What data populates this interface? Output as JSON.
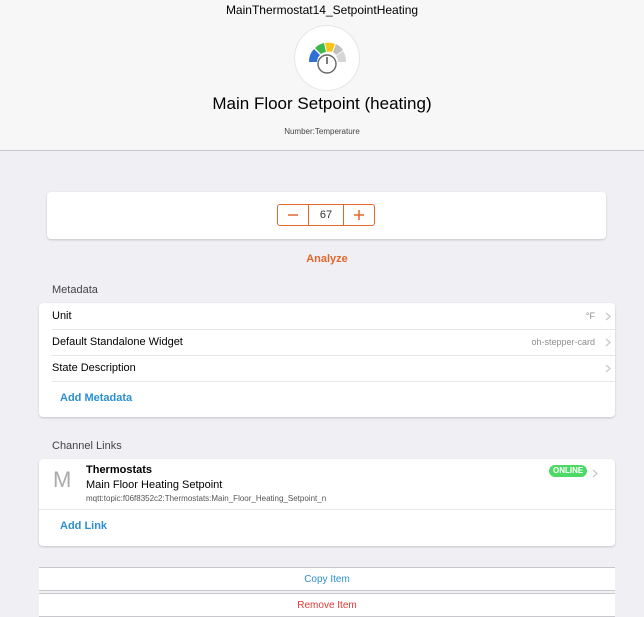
{
  "header": {
    "item_name": "MainThermostat14_SetpointHeating",
    "label": "Main Floor Setpoint (heating)",
    "type": "Number:Temperature",
    "icon": "thermostat-gauge-icon"
  },
  "stepper": {
    "value": "67",
    "decrement_icon": "minus-icon",
    "increment_icon": "plus-icon"
  },
  "analyze_label": "Analyze",
  "metadata": {
    "title": "Metadata",
    "rows": [
      {
        "label": "Unit",
        "after": "°F"
      },
      {
        "label": "Default Standalone Widget",
        "after": "oh-stepper-card"
      },
      {
        "label": "State Description",
        "after": ""
      }
    ],
    "add_label": "Add Metadata"
  },
  "channel_links": {
    "title": "Channel Links",
    "links": [
      {
        "icon_letter": "M",
        "title": "Thermostats",
        "subtitle": "Main Floor Heating Setpoint",
        "uid": "mqtt:topic:f06f8352c2:Thermostats:Main_Floor_Heating_Setpoint_n",
        "status": "ONLINE"
      }
    ],
    "add_label": "Add Link"
  },
  "actions": {
    "copy_label": "Copy Item",
    "remove_label": "Remove Item"
  },
  "colors": {
    "accent": "#e2672d",
    "link": "#2a8fd4",
    "online": "#4cd964",
    "danger": "#e53935"
  }
}
